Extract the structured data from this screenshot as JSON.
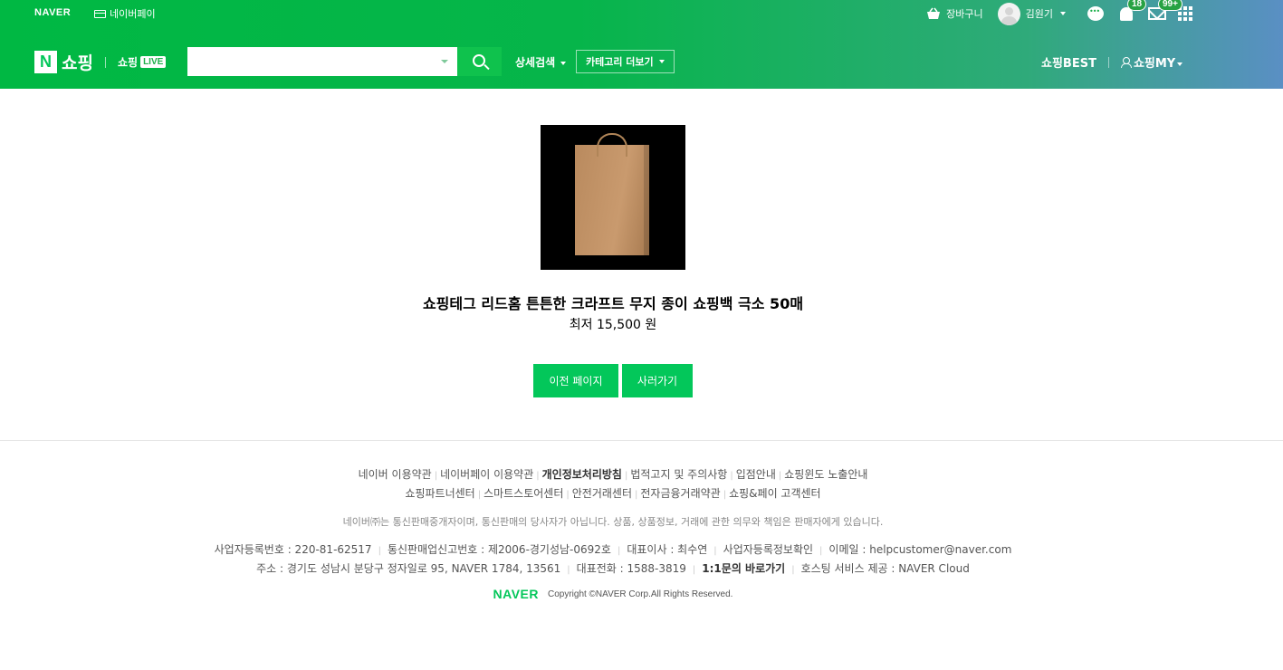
{
  "gnb": {
    "naver_logo": "NAVER",
    "npay_label": "네이버페이",
    "cart_label": "장바구니",
    "user_name": "김원기",
    "notification_count": "18",
    "mail_count": "99+"
  },
  "nav": {
    "shop_logo_n": "N",
    "shop_logo_word": "쇼핑",
    "live_prefix": "쇼핑",
    "live_tag": "LIVE",
    "search_placeholder": "",
    "detail_search": "상세검색",
    "category_more": "카테고리 더보기",
    "shopping_best": "쇼핑BEST",
    "shopping_my": "쇼핑MY"
  },
  "product": {
    "image_alt": "kraft paper shopping bag",
    "title": "쇼핑테그 리드홈 튼튼한 크라프트 무지 종이 쇼핑백 극소 50매",
    "price": "최저 15,500 원",
    "prev_button": "이전 페이지",
    "buy_button": "사러가기"
  },
  "footer": {
    "links_row1": [
      {
        "label": "네이버 이용약관",
        "bold": false
      },
      {
        "label": "네이버페이 이용약관",
        "bold": false
      },
      {
        "label": "개인정보처리방침",
        "bold": true
      },
      {
        "label": "법적고지 및 주의사항",
        "bold": false
      },
      {
        "label": "입점안내",
        "bold": false
      },
      {
        "label": "쇼핑윈도 노출안내",
        "bold": false
      }
    ],
    "links_row2": [
      {
        "label": "쇼핑파트너센터",
        "bold": false
      },
      {
        "label": "스마트스토어센터",
        "bold": false
      },
      {
        "label": "안전거래센터",
        "bold": false
      },
      {
        "label": "전자금융거래약관",
        "bold": false
      },
      {
        "label": "쇼핑&페이 고객센터",
        "bold": false
      }
    ],
    "notice": "네이버㈜는 통신판매중개자이며, 통신판매의 당사자가 아닙니다. 상품, 상품정보, 거래에 관한 의무와 책임은 판매자에게 있습니다.",
    "info_row1": [
      {
        "label": "사업자등록번호 : 220-81-62517",
        "bold": false
      },
      {
        "label": "통신판매업신고번호 : 제2006-경기성남-0692호",
        "bold": false
      },
      {
        "label": "대표이사 : 최수연",
        "bold": false
      },
      {
        "label": "사업자등록정보확인",
        "bold": false
      },
      {
        "label": "이메일 : helpcustomer@naver.com",
        "bold": false
      }
    ],
    "info_row2": [
      {
        "label": "주소 : 경기도 성남시 분당구 정자일로 95, NAVER 1784, 13561",
        "bold": false
      },
      {
        "label": "대표전화 : 1588-3819",
        "bold": false
      },
      {
        "label": "1:1문의 바로가기",
        "bold": true
      },
      {
        "label": "호스팅 서비스 제공 : NAVER Cloud",
        "bold": false
      }
    ],
    "copy_logo": "NAVER",
    "copyright": "Copyright ©NAVER Corp.All Rights Reserved."
  }
}
